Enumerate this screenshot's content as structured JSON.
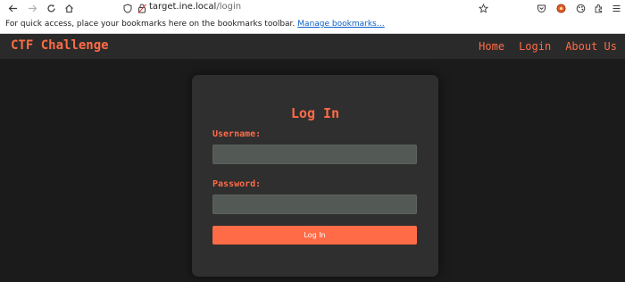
{
  "browser": {
    "url_host": "target.ine.local",
    "url_path": "/login",
    "icons": {
      "back": "back-arrow-icon",
      "forward": "forward-arrow-icon",
      "reload": "reload-icon",
      "home": "home-icon",
      "shield": "shield-icon",
      "lock": "lock-icon",
      "bookmark_star": "star-icon",
      "pocket": "pocket-icon",
      "extension1": "extension-icon",
      "extension2": "extension-icon",
      "menu": "hamburger-menu-icon"
    }
  },
  "bookmarks_bar": {
    "text": "For quick access, place your bookmarks here on the bookmarks toolbar.",
    "link": "Manage bookmarks…"
  },
  "header": {
    "brand": "CTF Challenge",
    "nav": [
      "Home",
      "Login",
      "About Us"
    ]
  },
  "login": {
    "title": "Log In",
    "username_label": "Username:",
    "username_value": "",
    "password_label": "Password:",
    "password_value": "",
    "submit_label": "Log In"
  },
  "colors": {
    "accent": "#ff6b47",
    "page_bg": "#1b1b1b",
    "header_bg": "#2a2a2a",
    "card_bg": "#2f2f2f",
    "input_bg": "#535a55"
  }
}
